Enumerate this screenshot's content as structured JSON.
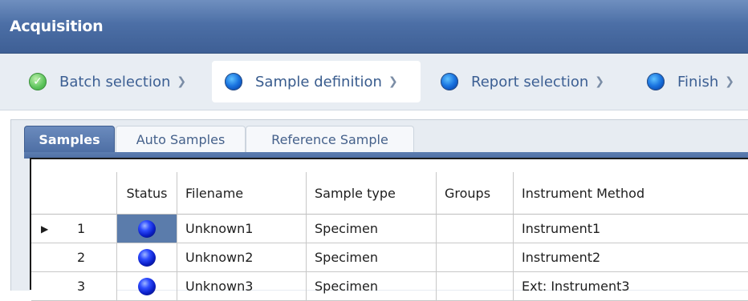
{
  "window": {
    "title": "Acquisition"
  },
  "steps": [
    {
      "label": "Batch selection",
      "state": "done"
    },
    {
      "label": "Sample definition",
      "state": "current"
    },
    {
      "label": "Report selection",
      "state": "pending"
    },
    {
      "label": "Finish",
      "state": "pending"
    }
  ],
  "tabs": [
    {
      "label": "Samples"
    },
    {
      "label": "Auto Samples"
    },
    {
      "label": "Reference Sample"
    }
  ],
  "grid": {
    "columns": [
      "",
      "Status",
      "Filename",
      "Sample type",
      "Groups",
      "Instrument Method"
    ],
    "rows": [
      {
        "index": "1",
        "filename": "Unknown1",
        "sample_type": "Specimen",
        "groups": "",
        "method": "Instrument1"
      },
      {
        "index": "2",
        "filename": "Unknown2",
        "sample_type": "Specimen",
        "groups": "",
        "method": "Instrument2"
      },
      {
        "index": "3",
        "filename": "Unknown3",
        "sample_type": "Specimen",
        "groups": "",
        "method": "Ext: Instrument3"
      }
    ]
  },
  "colors": {
    "titlebar": "#4c6fa6",
    "accent": "#3c5f93",
    "status_selected": "#5b7cab"
  }
}
